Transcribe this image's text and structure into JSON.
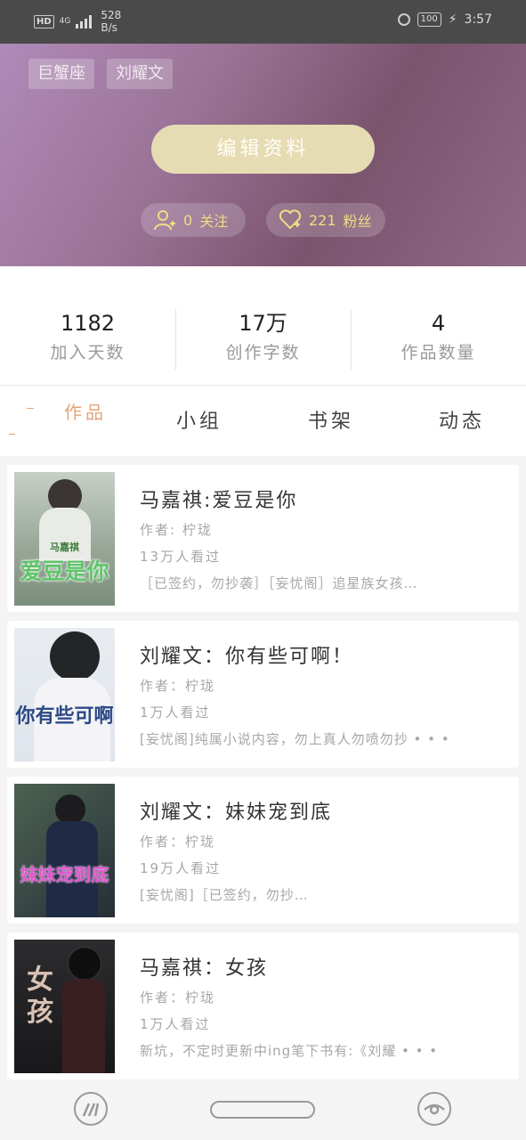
{
  "status_bar": {
    "hd": "HD",
    "network": "4G",
    "speed_value": "528",
    "speed_unit": "B/s",
    "battery": "100",
    "time": "3:57"
  },
  "profile": {
    "tags": [
      "巨蟹座",
      "刘耀文"
    ],
    "edit_button": "编辑资料",
    "follow_count": "0",
    "follow_label": "关注",
    "fans_count": "221",
    "fans_label": "粉丝"
  },
  "stats": [
    {
      "value": "1182",
      "label": "加入天数"
    },
    {
      "value": "17万",
      "label": "创作字数"
    },
    {
      "value": "4",
      "label": "作品数量"
    }
  ],
  "tabs": [
    {
      "label": "作品",
      "active": true
    },
    {
      "label": "小组",
      "active": false
    },
    {
      "label": "书架",
      "active": false
    },
    {
      "label": "动态",
      "active": false
    }
  ],
  "works": [
    {
      "title": "马嘉祺:爱豆是你",
      "author": "作者: 柠珑",
      "views": "13万人看过",
      "description": "［已签约，勿抄袭］［妄忧阁］追星族女孩…",
      "cover_text": "爱豆是你",
      "cover_subtext": "马嘉祺",
      "cover_colors": [
        "#c9d4c8",
        "#6f8c77",
        "#4fbf58"
      ]
    },
    {
      "title": "刘耀文：你有些可啊！",
      "author": "作者：柠珑",
      "views": "1万人看过",
      "description": "[妄忧阁]纯属小说内容，勿上真人勿喷勿抄 • • •",
      "cover_text": "你有些可啊",
      "cover_subtext": "",
      "cover_colors": [
        "#dfe6ee",
        "#3a4f70",
        "#2f4d86"
      ]
    },
    {
      "title": "刘耀文：妹妹宠到底",
      "author": "作者：柠珑",
      "views": "19万人看过",
      "description": "[妄忧阁]［已签约，勿抄…",
      "cover_text": "妹妹宠到底",
      "cover_subtext": "",
      "cover_colors": [
        "#4a5f52",
        "#2a3440",
        "#d64ec7"
      ]
    },
    {
      "title": "马嘉祺：女孩",
      "author": "作者：柠珑",
      "views": "1万人看过",
      "description": "新坑，不定时更新中ing笔下书有:《刘耀 • • •",
      "cover_text": "女孩",
      "cover_subtext": "",
      "cover_colors": [
        "#2a2a2c",
        "#1a1a1c",
        "#d8c2b4"
      ]
    }
  ]
}
